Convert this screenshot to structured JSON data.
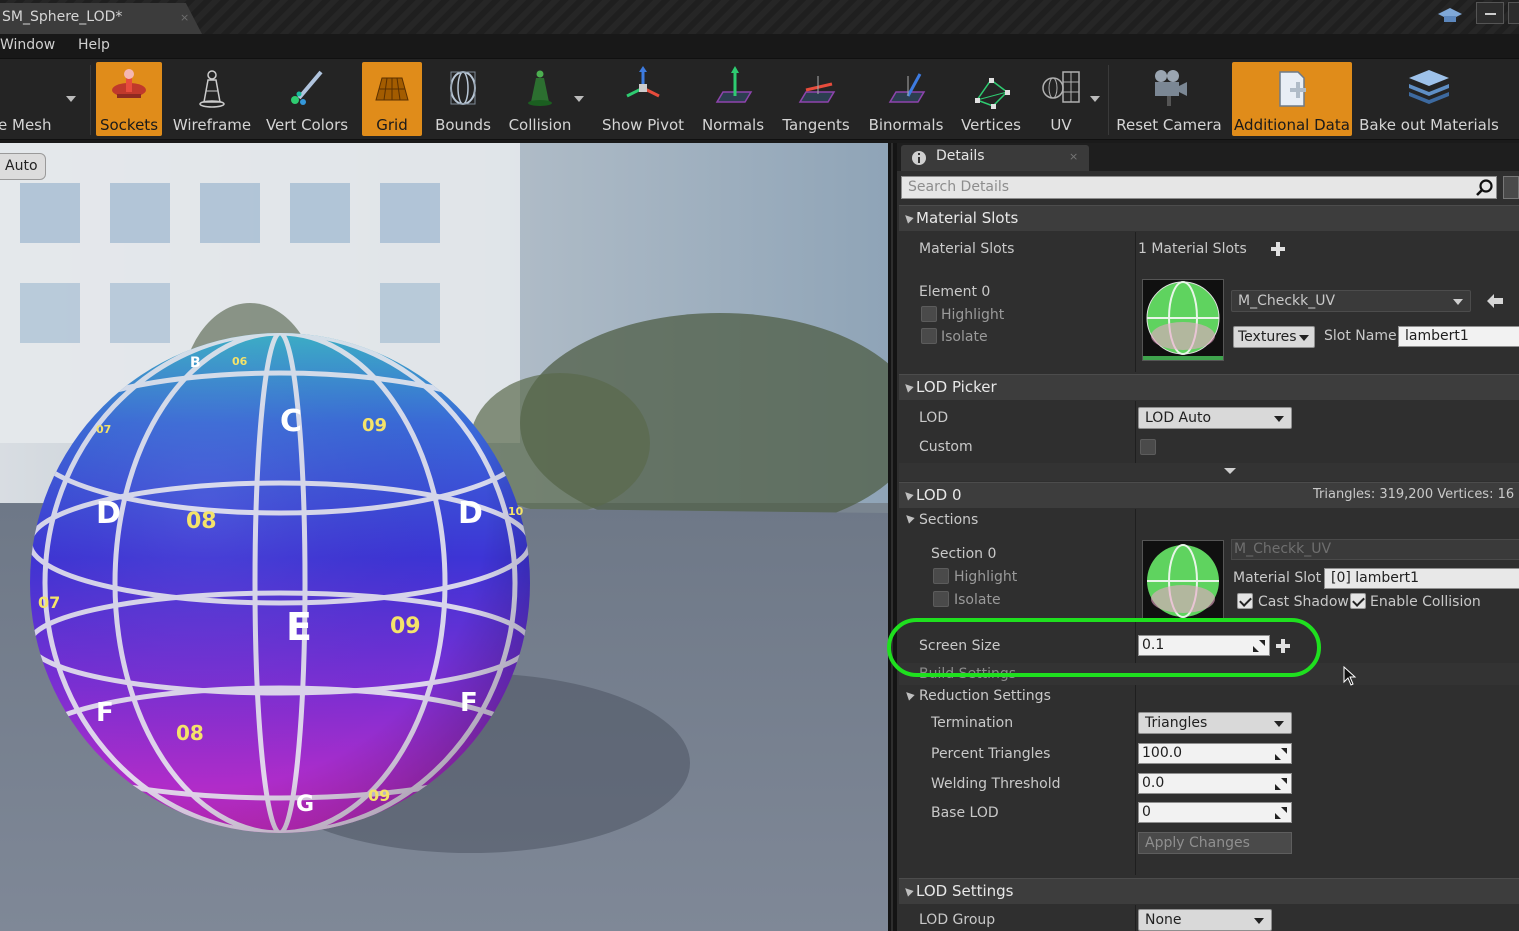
{
  "window": {
    "tab_title": "SM_Sphere_LOD*",
    "tab_close": "×"
  },
  "menu": [
    "Window",
    "Help"
  ],
  "toolbar": {
    "items": [
      {
        "label": "e Mesh",
        "icon": "mesh-icon",
        "active": false
      },
      {
        "label": "Sockets",
        "icon": "sockets-icon",
        "active": true
      },
      {
        "label": "Wireframe",
        "icon": "wireframe-icon",
        "active": false
      },
      {
        "label": "Vert Colors",
        "icon": "vert-colors-icon",
        "active": false
      },
      {
        "label": "Grid",
        "icon": "grid-icon",
        "active": true
      },
      {
        "label": "Bounds",
        "icon": "bounds-icon",
        "active": false
      },
      {
        "label": "Collision",
        "icon": "collision-icon",
        "active": false
      },
      {
        "label": "Show Pivot",
        "icon": "pivot-icon",
        "active": false
      },
      {
        "label": "Normals",
        "icon": "normals-icon",
        "active": false
      },
      {
        "label": "Tangents",
        "icon": "tangents-icon",
        "active": false
      },
      {
        "label": "Binormals",
        "icon": "binormals-icon",
        "active": false
      },
      {
        "label": "Vertices",
        "icon": "vertices-icon",
        "active": false
      },
      {
        "label": "UV",
        "icon": "uv-icon",
        "active": false
      },
      {
        "label": "Reset Camera",
        "icon": "camera-icon",
        "active": false
      },
      {
        "label": "Additional Data",
        "icon": "additional-data-icon",
        "active": true
      },
      {
        "label": "Bake out Materials",
        "icon": "bake-materials-icon",
        "active": false
      }
    ]
  },
  "viewport": {
    "lod_button": "Auto",
    "sphere_labels": [
      "C",
      "09",
      "D",
      "08",
      "D",
      "E",
      "09",
      "07",
      "F",
      "08",
      "F",
      "G",
      "09",
      "B",
      "06",
      "07",
      "10"
    ]
  },
  "details": {
    "tab_label": "Details",
    "tab_close": "×",
    "search_placeholder": "Search Details",
    "material_slots": {
      "header": "Material Slots",
      "label": "Material Slots",
      "count_text": "1 Material Slots",
      "element_label": "Element 0",
      "highlight": "Highlight",
      "isolate": "Isolate",
      "material_name": "M_Checkk_UV",
      "textures": "Textures",
      "slot_name_label": "Slot Name",
      "slot_name_value": "lambert1"
    },
    "lod_picker": {
      "header": "LOD Picker",
      "lod_label": "LOD",
      "lod_value": "LOD Auto",
      "custom_label": "Custom"
    },
    "lod0": {
      "header": "LOD 0",
      "stats": "Triangles: 319,200   Vertices: 16",
      "sections_label": "Sections",
      "section_label": "Section 0",
      "highlight": "Highlight",
      "isolate": "Isolate",
      "material_name": "M_Checkk_UV",
      "material_slot_label": "Material Slot",
      "material_slot_value": "[0] lambert1",
      "cast_shadow": "Cast Shadow",
      "enable_collision": "Enable Collision",
      "screen_size_label": "Screen Size",
      "screen_size_value": "0.1",
      "build_settings": "Build Settings",
      "reduction_settings": "Reduction Settings",
      "termination_label": "Termination",
      "termination_value": "Triangles",
      "percent_triangles_label": "Percent Triangles",
      "percent_triangles_value": "100.0",
      "welding_threshold_label": "Welding Threshold",
      "welding_threshold_value": "0.0",
      "base_lod_label": "Base LOD",
      "base_lod_value": "0",
      "apply_changes": "Apply Changes"
    },
    "lod_settings": {
      "header": "LOD Settings",
      "lod_group_label": "LOD Group",
      "lod_group_value": "None"
    }
  },
  "colors": {
    "active_orange": "#e08c1a",
    "highlight_green": "#1fe01f",
    "panel_bg": "#2f2f2f"
  }
}
